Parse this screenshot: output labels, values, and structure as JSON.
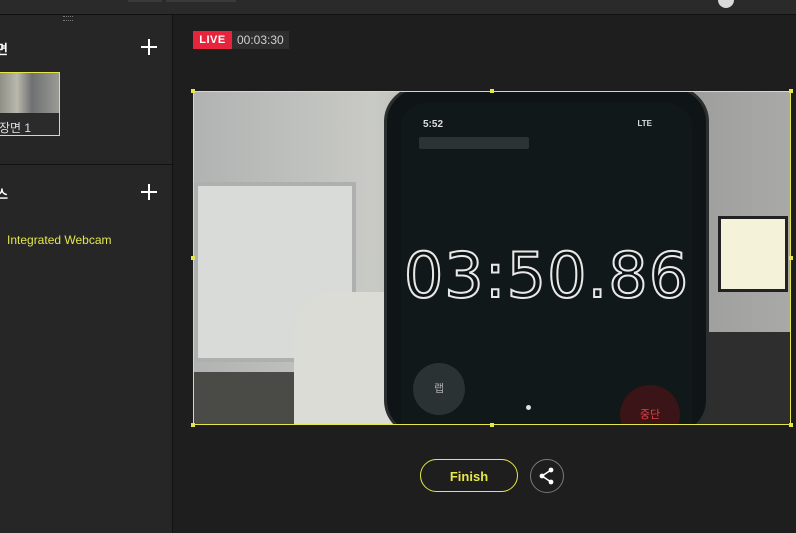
{
  "sidebar": {
    "scenes": {
      "title": "면",
      "items": [
        {
          "label": "장면 1"
        }
      ]
    },
    "sources": {
      "title": "스",
      "items": [
        {
          "label": "Integrated Webcam"
        }
      ]
    }
  },
  "stream": {
    "live_label": "LIVE",
    "elapsed": "00:03:30"
  },
  "preview": {
    "phone_time": "5:52",
    "phone_network": "LTE",
    "stopwatch": "03:50.86",
    "lap_label": "랩",
    "stop_label": "중단"
  },
  "actions": {
    "finish_label": "Finish"
  },
  "colors": {
    "accent": "#e6e64a",
    "live": "#e8243c"
  }
}
